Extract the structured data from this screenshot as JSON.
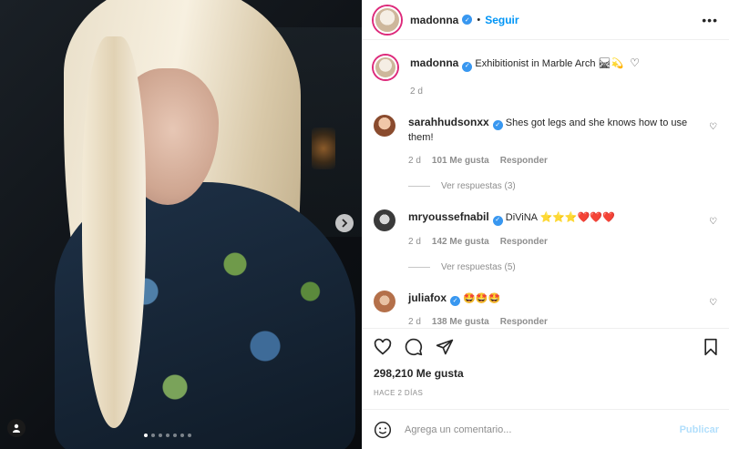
{
  "post": {
    "author": "madonna",
    "follow_label": "Seguir",
    "separator": "•",
    "more_label": "•••"
  },
  "caption": {
    "username": "madonna",
    "text": "Exhibitionist in Marble Arch 🛤💫",
    "time": "2 d"
  },
  "comments": [
    {
      "username": "sarahhudsonxx",
      "text": "Shes got legs and she knows how to use them!",
      "time": "2 d",
      "likes": "101 Me gusta",
      "reply_label": "Responder",
      "view_replies": "Ver respuestas (3)",
      "avatar_color": "#c98a6b"
    },
    {
      "username": "mryoussefnabil",
      "text": "DiViNA ⭐⭐⭐❤️❤️❤️",
      "time": "2 d",
      "likes": "142 Me gusta",
      "reply_label": "Responder",
      "view_replies": "Ver respuestas (5)",
      "avatar_color": "#555555"
    },
    {
      "username": "juliafox",
      "text": "🤩🤩🤩",
      "time": "2 d",
      "likes": "138 Me gusta",
      "reply_label": "Responder",
      "avatar_color": "#d9a27a"
    }
  ],
  "engagement": {
    "likes": "298,210 Me gusta",
    "date": "HACE 2 DÍAS"
  },
  "composer": {
    "placeholder": "Agrega un comentario...",
    "publish_label": "Publicar"
  },
  "carousel": {
    "total": 7,
    "active": 0
  },
  "colors": {
    "accent": "#0095f6",
    "verified": "#3897f0",
    "muted": "#8e8e8e"
  }
}
